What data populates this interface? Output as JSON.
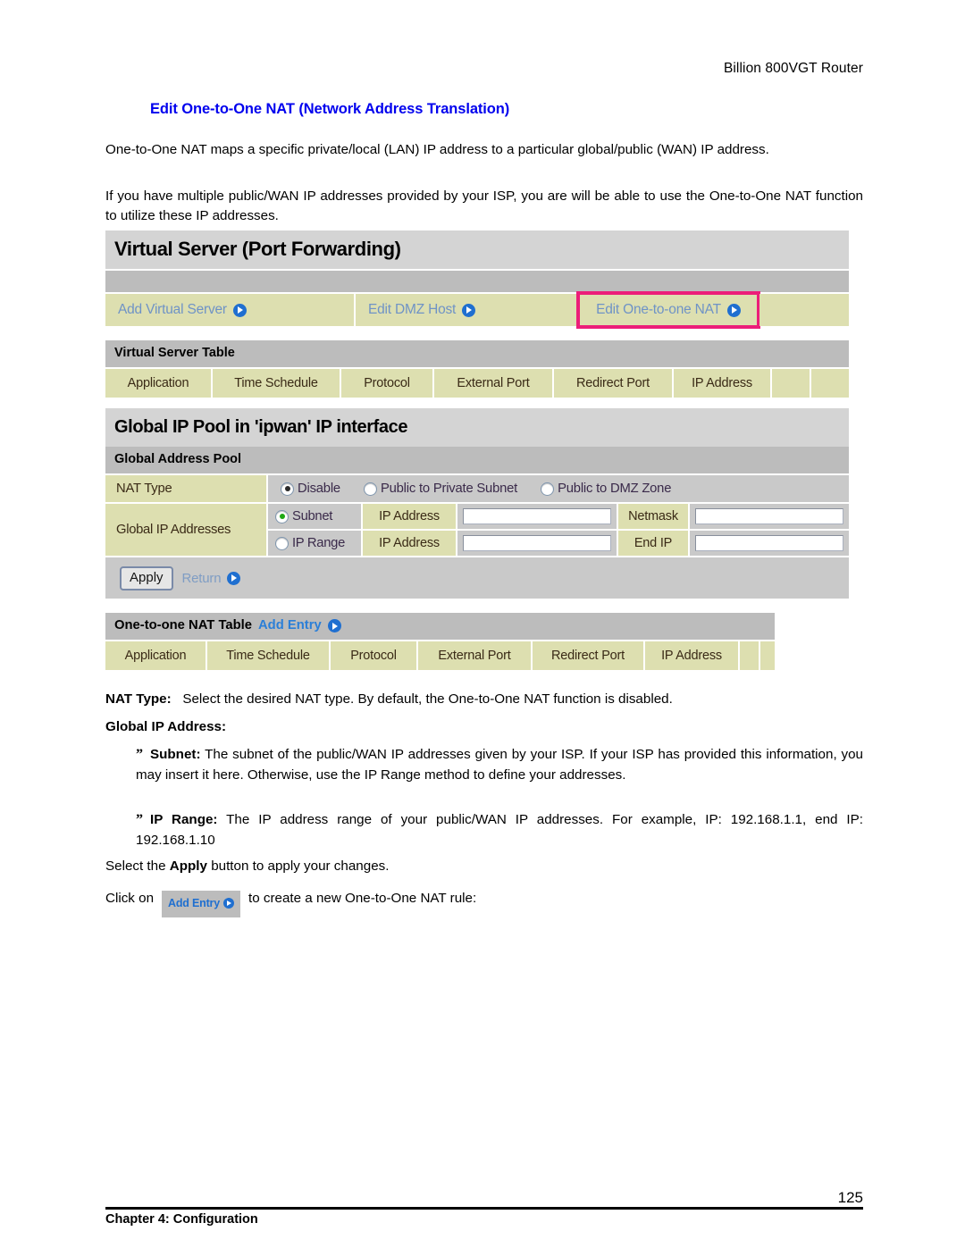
{
  "running_head": "Billion 800VGT Router",
  "heading": "Edit One-to-One NAT (Network Address Translation)",
  "paragraphs": {
    "intro1": "One-to-One NAT maps a specific private/local (LAN) IP address to a particular global/public (WAN) IP address.",
    "intro2": "If you have multiple public/WAN IP addresses provided by your ISP, you are will be able to use the One-to-One NAT function to utilize these IP addresses."
  },
  "router_ui": {
    "page_title": "Virtual Server (Port Forwarding)",
    "tabs": [
      {
        "label": "Add Virtual Server",
        "highlighted": false
      },
      {
        "label": "Edit DMZ Host",
        "highlighted": false
      },
      {
        "label": "Edit One-to-one NAT",
        "highlighted": true
      }
    ],
    "virtual_server_table": {
      "title": "Virtual Server Table",
      "columns": [
        "Application",
        "Time Schedule",
        "Protocol",
        "External Port",
        "Redirect Port",
        "IP Address"
      ]
    },
    "global_pool": {
      "title": "Global IP Pool in 'ipwan' IP interface",
      "subtitle": "Global Address Pool",
      "nat_type_label": "NAT Type",
      "nat_type_options": [
        {
          "label": "Disable",
          "selected": true
        },
        {
          "label": "Public to Private Subnet",
          "selected": false
        },
        {
          "label": "Public to DMZ Zone",
          "selected": false
        }
      ],
      "global_ip_label": "Global IP Addresses",
      "rows": [
        {
          "mode": "Subnet",
          "mode_selected": true,
          "field1_label": "IP Address",
          "field1_value": "",
          "field2_label": "Netmask",
          "field2_value": ""
        },
        {
          "mode": "IP Range",
          "mode_selected": false,
          "field1_label": "IP Address",
          "field1_value": "",
          "field2_label": "End IP",
          "field2_value": ""
        }
      ],
      "apply_label": "Apply",
      "return_label": "Return"
    },
    "oto_table": {
      "title": "One-to-one NAT Table",
      "add_entry_label": "Add Entry",
      "columns": [
        "Application",
        "Time Schedule",
        "Protocol",
        "External Port",
        "Redirect Port",
        "IP Address"
      ]
    }
  },
  "descriptions": {
    "nat_type_term": "NAT Type:",
    "nat_type_text": "Select the desired NAT type. By default, the One-to-One NAT function is disabled.",
    "global_ip_heading": "Global IP Address:",
    "bullet_mark": "”",
    "subnet_term": "Subnet:",
    "subnet_text": "The subnet of the public/WAN IP addresses given by your ISP.  If your ISP has provided this information, you may insert it here.  Otherwise, use the IP Range method to define your addresses.",
    "iprange_term": "IP Range:",
    "iprange_text": "The IP address range of your public/WAN IP addresses. For example, IP: 192.168.1.1, end IP: 192.168.1.10",
    "apply_pre": "Select the ",
    "apply_term": "Apply",
    "apply_post": " button to apply your changes.",
    "click_pre": "Click on",
    "click_chip": "Add Entry",
    "click_post": "to create a new One-to-One NAT rule:"
  },
  "footer": {
    "chapter": "Chapter 4: Configuration",
    "page_number": "125"
  },
  "colors": {
    "heading_blue": "#0000ee",
    "khaki": "#dddfb0",
    "gray_bar": "#bcbcbc",
    "title_bar": "#d4d4d4",
    "highlight_pink": "#ec1e79",
    "link_blue": "#6f93c6"
  }
}
